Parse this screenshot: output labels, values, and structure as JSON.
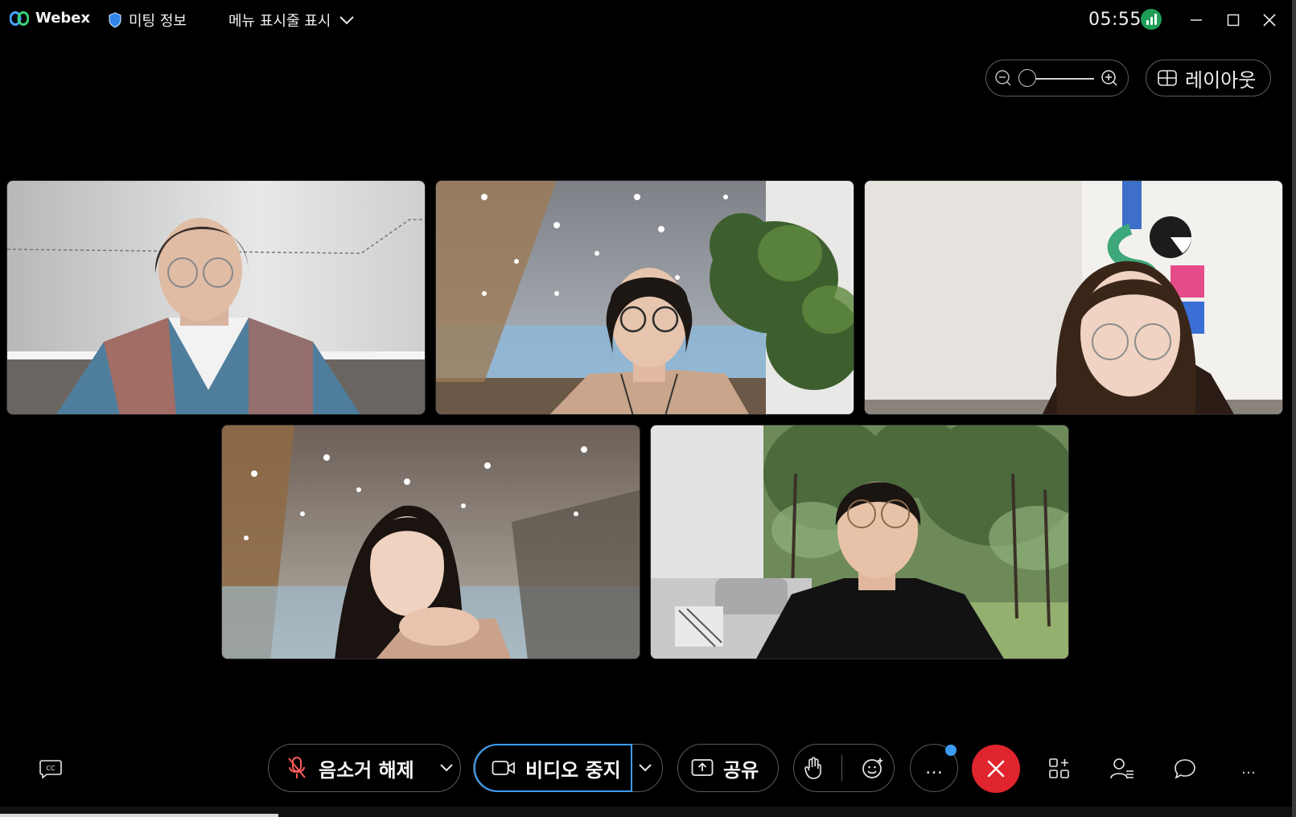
{
  "titlebar": {
    "app_name": "Webex",
    "meeting_info": "미팅 정보",
    "menu_toggle": "메뉴 표시줄 표시",
    "clock": "05:55"
  },
  "view": {
    "layout_label": "레이아웃",
    "zoom_level": 0
  },
  "participants": [
    {
      "tile": 1,
      "shirt": "#3f6f8f",
      "shirt2": "#c25a4a",
      "bg": "#d9d9d9"
    },
    {
      "tile": 2,
      "shirt": "#caa48a",
      "shirt2": "#caa48a",
      "bg": "#a9b2ba"
    },
    {
      "tile": 3,
      "shirt": "#e6e0da",
      "shirt2": "#e6e0da",
      "bg": "#e9e6e3"
    },
    {
      "tile": 4,
      "shirt": "#caa28a",
      "shirt2": "#caa28a",
      "bg": "#8d8478"
    },
    {
      "tile": 5,
      "shirt": "#111111",
      "shirt2": "#111111",
      "bg": "#6f8f5a"
    }
  ],
  "controls": {
    "unmute_label": "음소거 해제",
    "stop_video_label": "비디오 중지",
    "share_label": "공유",
    "more_glyph": "…",
    "overflow_glyph": "…"
  },
  "colors": {
    "end_call": "#e0252e",
    "signal": "#1f9e57",
    "focus_ring": "#3b9cf0",
    "notification_dot": "#3b9cf0"
  }
}
